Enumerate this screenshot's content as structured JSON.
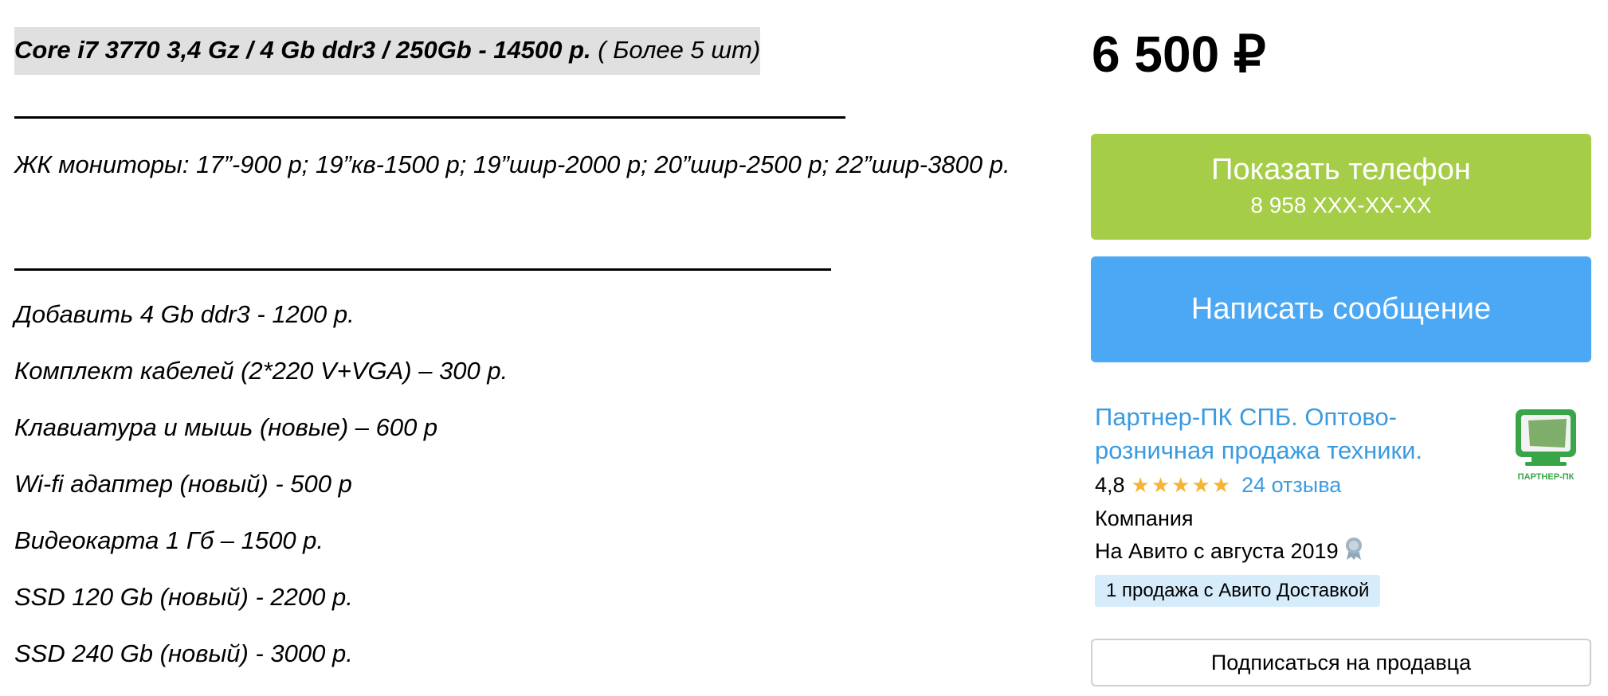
{
  "description": {
    "headline_bold": "Core i7 3770 3,4 Gz / 4 Gb ddr3 / 250Gb - 14500 р.",
    "headline_note": " ( Более 5 шт)",
    "monitors": "ЖК мониторы: 17”-900 р; 19”кв-1500 р; 19”шир-2000 р; 20”шир-2500 р; 22”шир-3800 р.",
    "extras": [
      "Добавить 4 Gb ddr3 - 1200 р.",
      "Комплект кабелей (2*220 V+VGA) – 300 р.",
      "Клавиатура и мышь (новые) – 600 р",
      "Wi-fi адаптер (новый) - 500 р",
      "Видеокарта 1 Гб – 1500 р.",
      "SSD 120 Gb (новый) - 2200 р.",
      "SSD 240 Gb (новый) - 3000 р."
    ]
  },
  "sidebar": {
    "price": "6 500 ₽",
    "phone_button": {
      "label": "Показать телефон",
      "phone": "8 958 XXX-XX-XX"
    },
    "message_button": "Написать сообщение",
    "seller": {
      "name": "Партнер-ПК СПБ. Оптово-розничная продажа техники.",
      "rating": "4,8",
      "stars": "★★★★★",
      "reviews": "24 отзыва",
      "type": "Компания",
      "since": "На Авито с августа 2019",
      "logo_text": "ПАРТНЕР-ПК",
      "delivery_badge": "1 продажа с Авито Доставкой"
    },
    "subscribe_button": "Подписаться на продавца"
  },
  "colors": {
    "phone_button": "#a5cd47",
    "message_button": "#4ba8f5",
    "link": "#3b9be0",
    "stars": "#f5b532",
    "badge_bg": "#d7ecfb",
    "highlight_bg": "#e0e0e0"
  },
  "icons": {
    "medal": "medal-icon",
    "logo": "partner-pc-logo-icon"
  }
}
